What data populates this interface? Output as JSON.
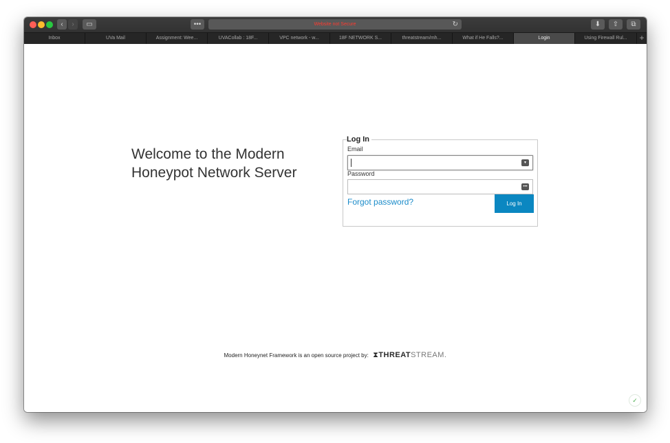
{
  "browser": {
    "address_text": "Website not Secure",
    "more_icon": "•••",
    "reload_icon": "↻",
    "tabs": [
      {
        "label": "Inbox"
      },
      {
        "label": "UVa Mail"
      },
      {
        "label": "Assignment: Wee..."
      },
      {
        "label": "UVACollab : 18F..."
      },
      {
        "label": "VPC network - w..."
      },
      {
        "label": "18F NETWORK S..."
      },
      {
        "label": "threatstream/mh..."
      },
      {
        "label": "What if He Falls?..."
      },
      {
        "label": "Login",
        "active": true
      },
      {
        "label": "Using Firewall Rul..."
      }
    ],
    "new_tab": "+"
  },
  "page": {
    "welcome": "Welcome to the Modern Honeypot Network Server",
    "login": {
      "legend": "Log In",
      "email_label": "Email",
      "email_value": "",
      "password_label": "Password",
      "password_value": "",
      "forgot": "Forgot password?",
      "button": "Log In"
    },
    "footer": {
      "text": "Modern Honeynet Framework is an open source project by:",
      "brand_bold": "THREAT",
      "brand_light": "STREAM."
    }
  },
  "colors": {
    "accent": "#0b87c1",
    "link": "#1a8bc9",
    "warning": "#ff3b30"
  }
}
